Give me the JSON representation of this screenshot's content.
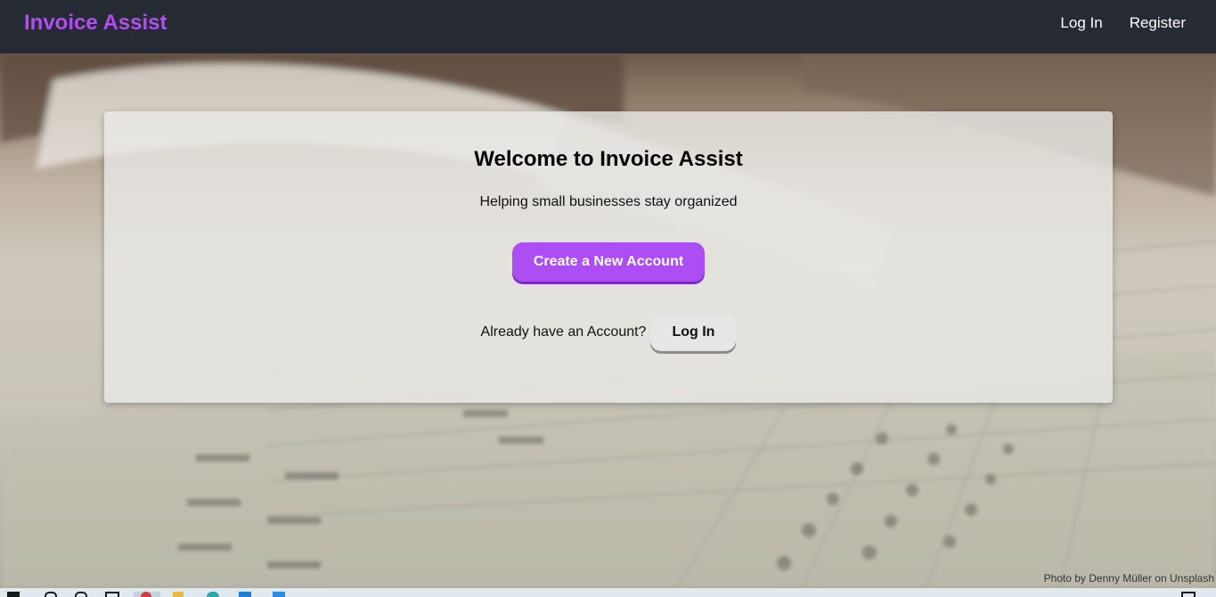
{
  "navbar": {
    "brand": "Invoice Assist",
    "links": [
      {
        "label": "Log In"
      },
      {
        "label": "Register"
      }
    ]
  },
  "card": {
    "title": "Welcome to Invoice Assist",
    "subtitle": "Helping small businesses stay organized",
    "create_button": "Create a New Account",
    "login_prompt": "Already have an Account?",
    "login_button": "Log In"
  },
  "background": {
    "credit": "Photo by Denny Müller on Unsplash"
  },
  "colors": {
    "brand": "#b04ef0",
    "navbar": "#262a33",
    "primary_button": "#ad4ef5",
    "secondary_button": "#e6e6e6"
  },
  "taskbar": {
    "icons": [
      "windows-start-icon",
      "search-icon",
      "task-view-icon",
      "store-icon",
      "chrome-icon",
      "file-explorer-icon",
      "edge-icon",
      "mail-icon",
      "vscode-icon",
      "notification-icon"
    ]
  }
}
